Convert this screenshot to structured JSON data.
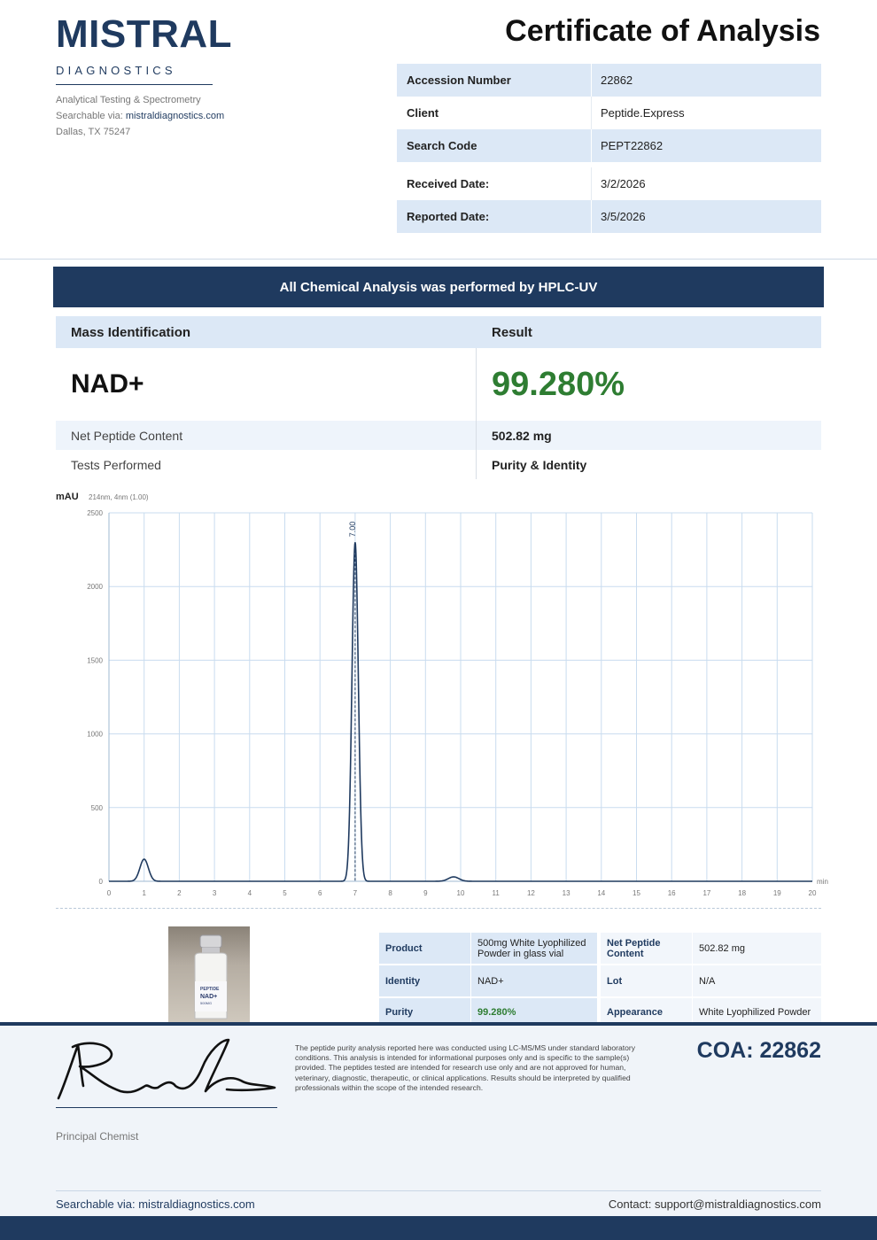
{
  "brand": {
    "name": "MISTRAL",
    "subtitle": "DIAGNOSTICS",
    "tagline": "Analytical Testing & Spectrometry",
    "searchable_prefix": "Searchable via: ",
    "searchable_link": "mistraldiagnostics.com",
    "location": "Dallas, TX 75247"
  },
  "header": {
    "title": "Certificate of Analysis"
  },
  "meta": [
    {
      "label": "Accession Number",
      "value": "22862"
    },
    {
      "label": "Client",
      "value": "Peptide.Express"
    },
    {
      "label": "Search Code",
      "value": "PEPT22862"
    },
    {
      "label": "Received Date:",
      "value": "3/2/2026"
    },
    {
      "label": "Reported Date:",
      "value": "3/5/2026"
    }
  ],
  "banner": "All Chemical Analysis was performed by HPLC-UV",
  "results": {
    "col1_header": "Mass Identification",
    "col2_header": "Result",
    "compound": "NAD+",
    "purity": "99.280%",
    "rows": [
      {
        "label": "Net Peptide Content",
        "value": "502.82 mg"
      },
      {
        "label": "Tests Performed",
        "value": "Purity & Identity"
      }
    ]
  },
  "chart_data": {
    "type": "line",
    "ylabel": "mAU",
    "detector_note": "214nm, 4nm (1.00)",
    "xlabel": "min",
    "xlim": [
      0,
      20
    ],
    "ylim": [
      0,
      2500
    ],
    "x_ticks": [
      0,
      1,
      2,
      3,
      4,
      5,
      6,
      7,
      8,
      9,
      10,
      11,
      12,
      13,
      14,
      15,
      16,
      17,
      18,
      19,
      20
    ],
    "y_ticks": [
      0,
      500,
      1000,
      1500,
      2000,
      2500
    ],
    "grid": true,
    "peak_label": "7.00",
    "peak_label_x": 7.0,
    "series": [
      {
        "peaks": [
          {
            "center": 1.0,
            "height": 150,
            "sigma": 0.12
          },
          {
            "center": 7.0,
            "height": 2300,
            "sigma": 0.09
          },
          {
            "center": 9.8,
            "height": 30,
            "sigma": 0.15
          }
        ]
      }
    ]
  },
  "product": {
    "rows": [
      {
        "l1": "Product",
        "v1": "500mg White Lyophilized Powder in glass vial",
        "l2": "Net Peptide Content",
        "v2": "502.82 mg"
      },
      {
        "l1": "Identity",
        "v1": "NAD+",
        "l2": "Lot",
        "v2": "N/A"
      },
      {
        "l1": "Purity",
        "v1": "99.280%",
        "l2": "Appearance",
        "v2": "White Lyophilized Powder"
      }
    ],
    "vial_text_1": "PEPTIDE",
    "vial_text_2": "NAD+",
    "vial_text_3": "500MG"
  },
  "footer": {
    "signer_title": "Principal Chemist",
    "disclaimer": "The peptide purity analysis reported here was conducted using LC-MS/MS under standard laboratory conditions. This analysis is intended for informational purposes only and is specific to the sample(s) provided. The peptides tested are intended for research use only and are not approved for human, veterinary, diagnostic, therapeutic, or clinical applications. Results should be interpreted by qualified professionals within the scope of the intended research.",
    "coa": "COA: 22862",
    "searchable": "Searchable via: mistraldiagnostics.com",
    "contact": "Contact: support@mistraldiagnostics.com"
  }
}
